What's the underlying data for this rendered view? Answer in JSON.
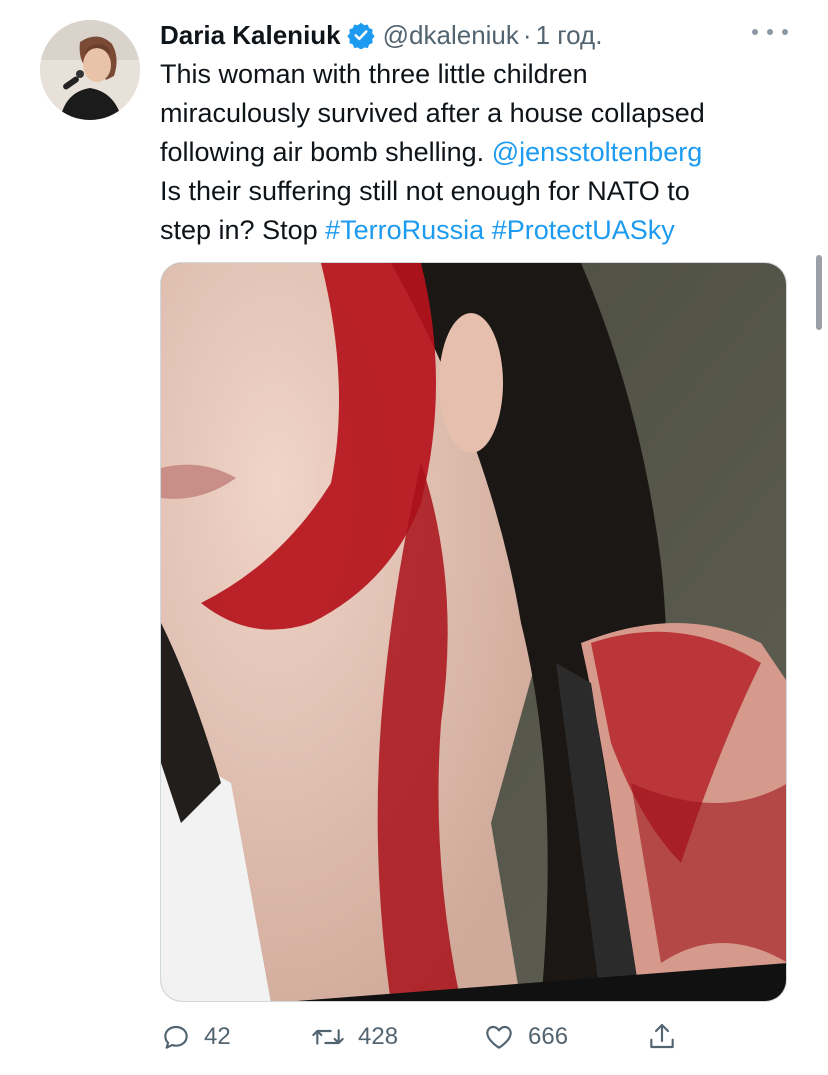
{
  "author": {
    "name": "Daria Kaleniuk",
    "handle": "@dkaleniuk",
    "separator": "·",
    "time": "1 год.",
    "verified": true
  },
  "tweet_text": {
    "line1": "This woman with three little children",
    "line2": "miraculously survived after a house collapsed",
    "line3_text": "following air bomb shelling. ",
    "line3_mention": "@jensstoltenberg",
    "line4": "Is their suffering still not enough for NATO to",
    "line5_text": "step in? Stop ",
    "hashtag1": "#TerroRussia",
    "hashtag2": "#ProtectUASky"
  },
  "actions": {
    "reply_count": "42",
    "retweet_count": "428",
    "like_count": "666"
  },
  "colors": {
    "link": "#1d9bf0",
    "muted": "#536471",
    "verified": "#1d9bf0"
  },
  "icons": [
    "verified-badge-icon",
    "more-icon",
    "reply-icon",
    "retweet-icon",
    "like-icon",
    "share-icon"
  ]
}
